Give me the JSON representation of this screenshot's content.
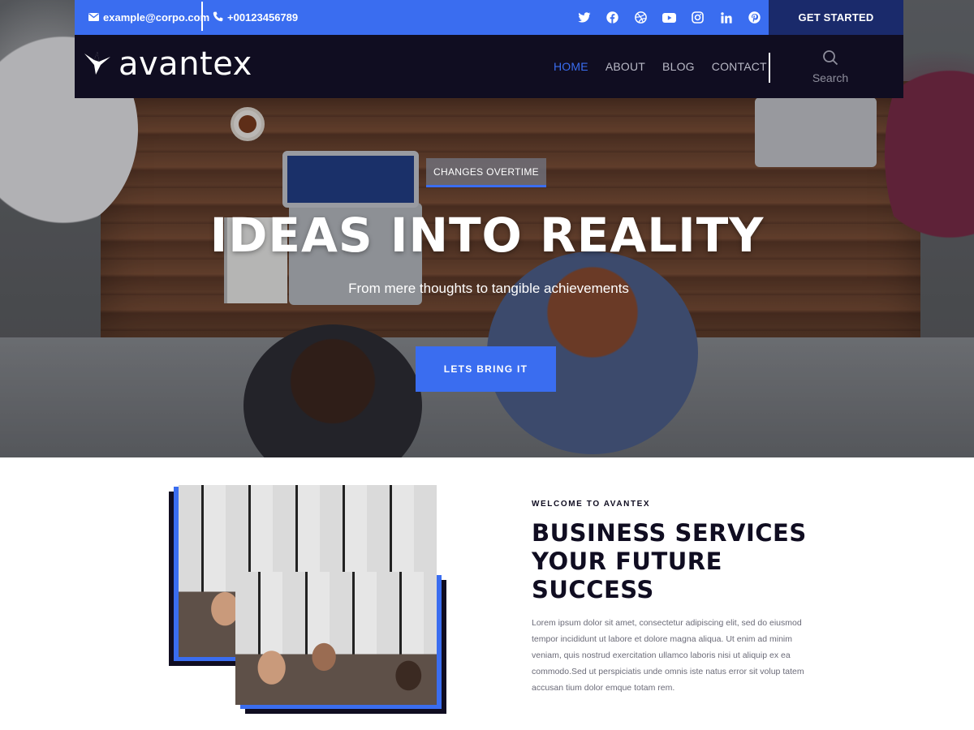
{
  "topbar": {
    "email": "example@corpo.com",
    "phone": "+00123456789",
    "socials": [
      "twitter-icon",
      "facebook-icon",
      "dribbble-icon",
      "youtube-icon",
      "instagram-icon",
      "linkedin-icon",
      "pinterest-icon"
    ],
    "cta_label": "GET STARTED"
  },
  "nav": {
    "logo_text": "avantex",
    "links": [
      {
        "label": "HOME",
        "active": true
      },
      {
        "label": "ABOUT",
        "active": false
      },
      {
        "label": "BLOG",
        "active": false
      },
      {
        "label": "CONTACT",
        "active": false
      }
    ],
    "search_label": "Search"
  },
  "hero": {
    "badge": "CHANGES OVERTIME",
    "title": "IDEAS INTO REALITY",
    "subtitle": "From mere thoughts to tangible achievements",
    "button_label": "LETS BRING IT"
  },
  "about": {
    "eyebrow": "WELCOME TO AVANTEX",
    "title": "BUSINESS SERVICES YOUR FUTURE SUCCESS",
    "body": "Lorem ipsum dolor sit amet, consectetur adipiscing elit, sed do eiusmod tempor incididunt ut labore et dolore magna aliqua. Ut enim ad minim veniam, quis nostrud exercitation ullamco laboris nisi ut aliquip ex ea commodo.Sed ut perspiciatis unde omnis iste natus error sit volup tatem accusan tium dolor emque totam rem."
  },
  "colors": {
    "accent": "#3a6df0",
    "dark_navy": "#100d21",
    "deep_blue": "#1a2a6b"
  }
}
